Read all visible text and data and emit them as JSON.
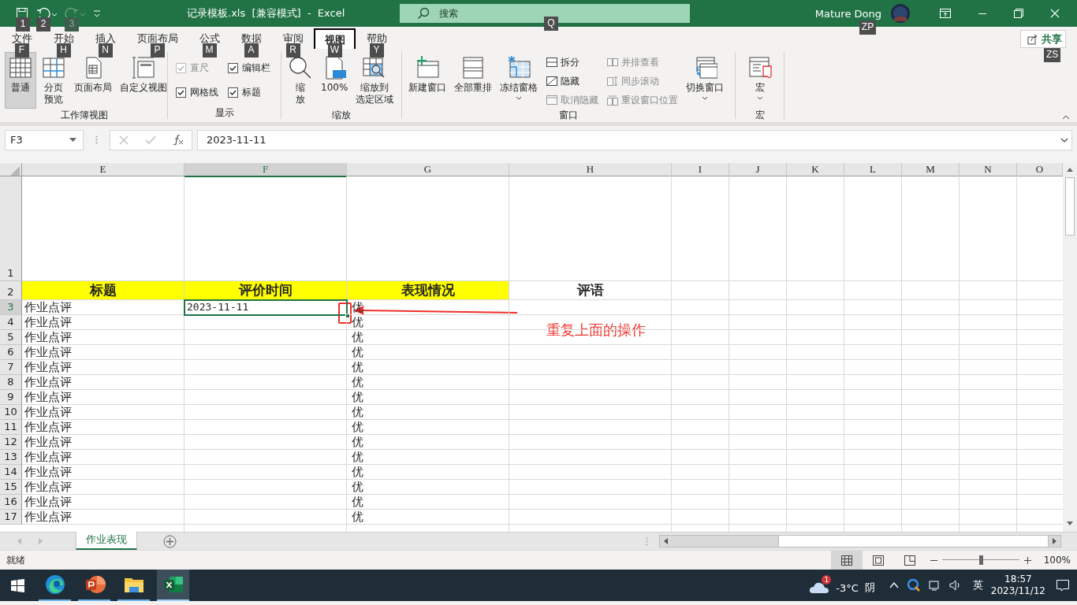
{
  "window": {
    "title": "记录模板.xls  [兼容模式]  -  Excel",
    "user": "Mature Dong",
    "user_keytip": "ZP"
  },
  "quick_access": [
    {
      "kind": "save",
      "keytip": "1",
      "disabled": false
    },
    {
      "kind": "undo",
      "keytip": "2",
      "disabled": false
    },
    {
      "kind": "redo",
      "keytip": "3",
      "disabled": true
    },
    {
      "kind": "customize",
      "disabled": false
    }
  ],
  "search": {
    "placeholder": "搜索",
    "keytip": "Q"
  },
  "tabs": [
    {
      "label": "文件",
      "keytip": "F",
      "selected": false
    },
    {
      "label": "开始",
      "keytip": "H",
      "selected": false
    },
    {
      "label": "插入",
      "keytip": "N",
      "selected": false
    },
    {
      "label": "页面布局",
      "keytip": "P",
      "selected": false
    },
    {
      "label": "公式",
      "keytip": "M",
      "selected": false
    },
    {
      "label": "数据",
      "keytip": "A",
      "selected": false
    },
    {
      "label": "审阅",
      "keytip": "R",
      "selected": false
    },
    {
      "label": "视图",
      "keytip": "W",
      "selected": true
    },
    {
      "label": "帮助",
      "keytip": "Y",
      "selected": false
    }
  ],
  "share": {
    "label": "共享",
    "keytip": "ZS"
  },
  "ribbon": {
    "groups": [
      {
        "label": "工作簿视图",
        "items": [
          {
            "kind": "large",
            "label": [
              "普通"
            ],
            "selected": true,
            "dropdown": false
          },
          {
            "kind": "large",
            "label": [
              "分页",
              "预览"
            ],
            "selected": false,
            "dropdown": false
          },
          {
            "kind": "large",
            "label": [
              "页面布局"
            ],
            "selected": false,
            "dropdown": false
          },
          {
            "kind": "large",
            "label": [
              "自定义视图"
            ],
            "selected": false,
            "dropdown": false
          }
        ]
      },
      {
        "label": "显示",
        "items": [
          {
            "kind": "check",
            "label": "直尺",
            "checked": true,
            "disabled": true
          },
          {
            "kind": "check",
            "label": "编辑栏",
            "checked": true,
            "disabled": false
          },
          {
            "kind": "check",
            "label": "网格线",
            "checked": true,
            "disabled": false
          },
          {
            "kind": "check",
            "label": "标题",
            "checked": true,
            "disabled": false
          }
        ]
      },
      {
        "label": "缩放",
        "items": [
          {
            "kind": "large",
            "label": [
              "缩",
              "放"
            ],
            "selected": false,
            "dropdown": false
          },
          {
            "kind": "large",
            "label": [
              "100%"
            ],
            "selected": false,
            "dropdown": false
          },
          {
            "kind": "large",
            "label": [
              "缩放到",
              "选定区域"
            ],
            "selected": false,
            "dropdown": false
          }
        ]
      },
      {
        "label": "窗口",
        "items": [
          {
            "kind": "large",
            "label": [
              "新建窗口"
            ],
            "selected": false,
            "dropdown": false
          },
          {
            "kind": "large",
            "label": [
              "全部重排"
            ],
            "selected": false,
            "dropdown": false
          },
          {
            "kind": "large",
            "label": [
              "冻结窗格"
            ],
            "selected": false,
            "dropdown": true
          },
          {
            "kind": "stack",
            "items": [
              {
                "label": "拆分",
                "disabled": false
              },
              {
                "label": "隐藏",
                "disabled": false
              },
              {
                "label": "取消隐藏",
                "disabled": true
              }
            ]
          },
          {
            "kind": "stack",
            "items": [
              {
                "label": "并排查看",
                "disabled": true
              },
              {
                "label": "同步滚动",
                "disabled": true
              },
              {
                "label": "重设窗口位置",
                "disabled": true
              }
            ]
          },
          {
            "kind": "large",
            "label": [
              "切换窗口"
            ],
            "selected": false,
            "dropdown": true
          }
        ]
      },
      {
        "label": "宏",
        "items": [
          {
            "kind": "large",
            "label": [
              "宏"
            ],
            "selected": false,
            "dropdown": true
          }
        ]
      }
    ]
  },
  "formula_bar": {
    "name_box": "F3",
    "value": "2023-11-11"
  },
  "columns": [
    {
      "label": "E",
      "selected": false
    },
    {
      "label": "F",
      "selected": true
    },
    {
      "label": "G",
      "selected": false
    },
    {
      "label": "H",
      "selected": false
    },
    {
      "label": "I",
      "selected": false
    },
    {
      "label": "J",
      "selected": false
    },
    {
      "label": "K",
      "selected": false
    },
    {
      "label": "L",
      "selected": false
    },
    {
      "label": "M",
      "selected": false
    },
    {
      "label": "N",
      "selected": false
    },
    {
      "label": "O",
      "selected": false
    }
  ],
  "rows": [
    {
      "number": "1",
      "kind": "spacer",
      "selected": false
    },
    {
      "number": "2",
      "kind": "header",
      "selected": false,
      "e": {
        "text": "标题",
        "highlight": true
      },
      "f": {
        "text": "评价时间",
        "highlight": true
      },
      "g": {
        "text": "表现情况",
        "highlight": true
      },
      "h": {
        "text": "评语",
        "highlight": false
      }
    },
    {
      "number": "3",
      "kind": "data",
      "selected": true,
      "e": {
        "text": "作业点评"
      },
      "f": {
        "text": "2023-11-11"
      },
      "g": {
        "text": "优"
      }
    },
    {
      "number": "4",
      "kind": "data",
      "selected": false,
      "e": {
        "text": "作业点评"
      },
      "g": {
        "text": "优"
      }
    },
    {
      "number": "5",
      "kind": "data",
      "selected": false,
      "e": {
        "text": "作业点评"
      },
      "g": {
        "text": "优"
      }
    },
    {
      "number": "6",
      "kind": "data",
      "selected": false,
      "e": {
        "text": "作业点评"
      },
      "g": {
        "text": "优"
      }
    },
    {
      "number": "7",
      "kind": "data",
      "selected": false,
      "e": {
        "text": "作业点评"
      },
      "g": {
        "text": "优"
      }
    },
    {
      "number": "8",
      "kind": "data",
      "selected": false,
      "e": {
        "text": "作业点评"
      },
      "g": {
        "text": "优"
      }
    },
    {
      "number": "9",
      "kind": "data",
      "selected": false,
      "e": {
        "text": "作业点评"
      },
      "g": {
        "text": "优"
      }
    },
    {
      "number": "10",
      "kind": "data",
      "selected": false,
      "e": {
        "text": "作业点评"
      },
      "g": {
        "text": "优"
      }
    },
    {
      "number": "11",
      "kind": "data",
      "selected": false,
      "e": {
        "text": "作业点评"
      },
      "g": {
        "text": "优"
      }
    },
    {
      "number": "12",
      "kind": "data",
      "selected": false,
      "e": {
        "text": "作业点评"
      },
      "g": {
        "text": "优"
      }
    },
    {
      "number": "13",
      "kind": "data",
      "selected": false,
      "e": {
        "text": "作业点评"
      },
      "g": {
        "text": "优"
      }
    },
    {
      "number": "14",
      "kind": "data",
      "selected": false,
      "e": {
        "text": "作业点评"
      },
      "g": {
        "text": "优"
      }
    },
    {
      "number": "15",
      "kind": "data",
      "selected": false,
      "e": {
        "text": "作业点评"
      },
      "g": {
        "text": "优"
      }
    },
    {
      "number": "16",
      "kind": "data",
      "selected": false,
      "e": {
        "text": "作业点评"
      },
      "g": {
        "text": "优"
      }
    },
    {
      "number": "17",
      "kind": "data",
      "selected": false,
      "e": {
        "text": "作业点评"
      },
      "g": {
        "text": "优"
      }
    }
  ],
  "annotation": {
    "text": "重复上面的操作"
  },
  "sheet_tabs": [
    {
      "label": "作业表现",
      "selected": true
    }
  ],
  "status_bar": {
    "text": "就绪",
    "views": [
      {
        "kind": "normal",
        "selected": true
      },
      {
        "kind": "page-layout",
        "selected": false
      },
      {
        "kind": "page-break",
        "selected": false
      }
    ],
    "zoom": {
      "level": 0.5,
      "reading": "100%"
    }
  },
  "taskbar": {
    "apps": [
      {
        "kind": "edge",
        "active": false
      },
      {
        "kind": "powerpoint",
        "active": false
      },
      {
        "kind": "folder",
        "active": false
      },
      {
        "kind": "excel",
        "active": true
      }
    ],
    "weather": {
      "badge": "1",
      "temperature": "-3°C",
      "condition": "阴"
    },
    "ime": "英",
    "time": "18:57",
    "date": "2023/11/12"
  }
}
